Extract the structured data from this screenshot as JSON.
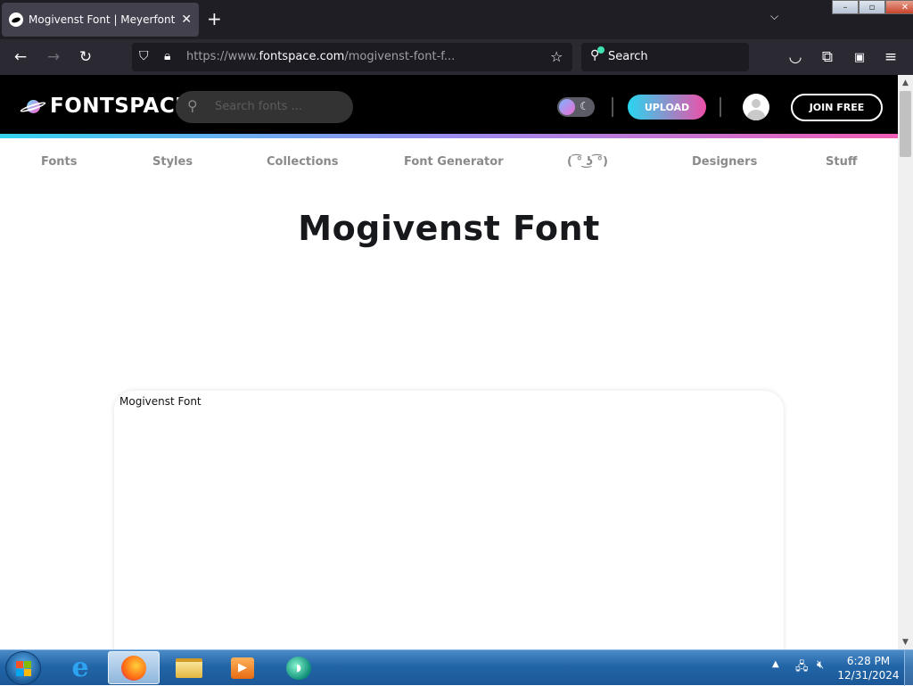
{
  "browser": {
    "tab_title": "Mogivenst Font | Meyerfonts | Fo",
    "new_tab_icon": "+",
    "url_prefix": "https://www.",
    "url_host": "fontspace.com",
    "url_path": "/mogivenst-font-f...",
    "search_placeholder": "Search"
  },
  "site": {
    "logo_text": "FONTSPACE",
    "search_placeholder": "Search fonts ...",
    "upload_label": "UPLOAD",
    "join_label": "JOIN FREE",
    "nav": [
      "Fonts",
      "Styles",
      "Collections",
      "Font Generator",
      "( ͡° ͜ʖ ͡°)",
      "Designers",
      "Stuff"
    ],
    "page_title": "Mogivenst Font",
    "preview_text": "Mogivenst Font"
  },
  "taskbar": {
    "time": "6:28 PM",
    "date": "12/31/2024"
  },
  "colors": {
    "accent_cyan": "#28d6f0",
    "accent_pink": "#ee4fa8",
    "header_bg": "#000000",
    "firefox_chrome": "#2b2a33"
  }
}
